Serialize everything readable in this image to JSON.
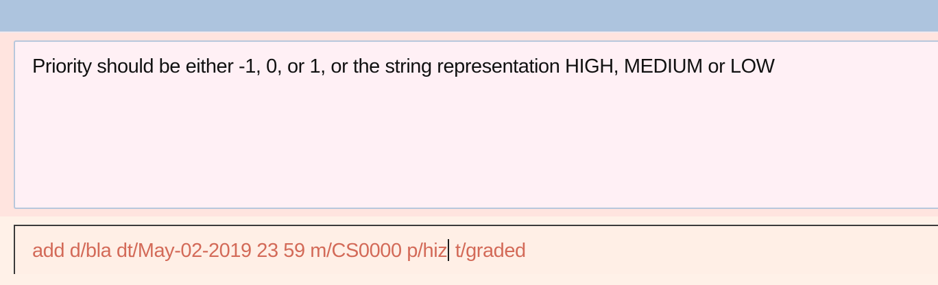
{
  "colors": {
    "top_bar": "#adc4de",
    "background": "#ffe4df",
    "result_box_background": "#fff0f5",
    "result_box_border": "#b7c7dc",
    "command_background": "#ffefe6",
    "command_text": "#d36a58",
    "command_border": "#3a3a3a"
  },
  "result_display": {
    "message": "Priority should be either -1, 0, or 1, or the string representation HIGH, MEDIUM or LOW"
  },
  "command_box": {
    "value_before_caret": "add d/bla dt/May-02-2019 23 59 m/CS0000 p/hiz",
    "value_after_caret": " t/graded"
  }
}
